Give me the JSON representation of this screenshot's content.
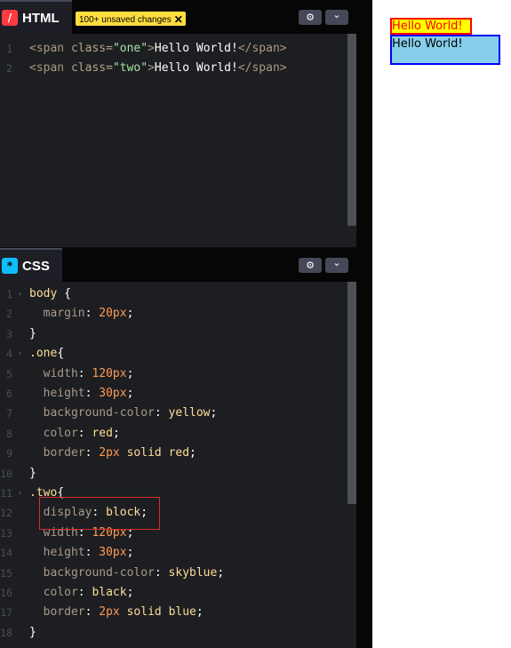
{
  "html_pane": {
    "tab_label": "HTML",
    "icon": "html-slash-icon",
    "icon_glyph": "/",
    "badge_text": "100+ unsaved changes",
    "badge_close": "✕",
    "settings_icon": "gear-icon",
    "settings_glyph": "⚙",
    "collapse_icon": "chevron-down-icon",
    "collapse_glyph": "⌄",
    "lines": [
      {
        "n": "1",
        "tokens": [
          [
            "tag",
            "<span "
          ],
          [
            "attr",
            "class="
          ],
          [
            "str",
            "\"one\""
          ],
          [
            "tag",
            ">"
          ],
          [
            "txt",
            "Hello World!"
          ],
          [
            "tag",
            "</span>"
          ]
        ]
      },
      {
        "n": "2",
        "tokens": [
          [
            "tag",
            "<span "
          ],
          [
            "attr",
            "class="
          ],
          [
            "str",
            "\"two\""
          ],
          [
            "tag",
            ">"
          ],
          [
            "txt",
            "Hello World!"
          ],
          [
            "tag",
            "</span>"
          ]
        ]
      }
    ]
  },
  "css_pane": {
    "tab_label": "CSS",
    "icon": "css-asterisk-icon",
    "icon_glyph": "*",
    "settings_icon": "gear-icon",
    "settings_glyph": "⚙",
    "collapse_icon": "chevron-down-icon",
    "collapse_glyph": "⌄",
    "lines": [
      {
        "n": "1",
        "fold": true,
        "tokens": [
          [
            "sel",
            "body "
          ],
          [
            "pun",
            "{"
          ]
        ]
      },
      {
        "n": "2",
        "tokens": [
          [
            "pun",
            "  "
          ],
          [
            "prop",
            "margin"
          ],
          [
            "pun",
            ": "
          ],
          [
            "num",
            "20px"
          ],
          [
            "pun",
            ";"
          ]
        ]
      },
      {
        "n": "3",
        "tokens": [
          [
            "pun",
            "}"
          ]
        ]
      },
      {
        "n": "4",
        "fold": true,
        "tokens": [
          [
            "sel",
            ".one"
          ],
          [
            "pun",
            "{"
          ]
        ]
      },
      {
        "n": "5",
        "tokens": [
          [
            "pun",
            "  "
          ],
          [
            "prop",
            "width"
          ],
          [
            "pun",
            ": "
          ],
          [
            "num",
            "120px"
          ],
          [
            "pun",
            ";"
          ]
        ]
      },
      {
        "n": "6",
        "tokens": [
          [
            "pun",
            "  "
          ],
          [
            "prop",
            "height"
          ],
          [
            "pun",
            ": "
          ],
          [
            "num",
            "30px"
          ],
          [
            "pun",
            ";"
          ]
        ]
      },
      {
        "n": "7",
        "tokens": [
          [
            "pun",
            "  "
          ],
          [
            "prop",
            "background-color"
          ],
          [
            "pun",
            ": "
          ],
          [
            "kw",
            "yellow"
          ],
          [
            "pun",
            ";"
          ]
        ]
      },
      {
        "n": "8",
        "tokens": [
          [
            "pun",
            "  "
          ],
          [
            "prop",
            "color"
          ],
          [
            "pun",
            ": "
          ],
          [
            "kw",
            "red"
          ],
          [
            "pun",
            ";"
          ]
        ]
      },
      {
        "n": "9",
        "tokens": [
          [
            "pun",
            "  "
          ],
          [
            "prop",
            "border"
          ],
          [
            "pun",
            ": "
          ],
          [
            "num",
            "2px"
          ],
          [
            "pun",
            " "
          ],
          [
            "kw",
            "solid"
          ],
          [
            "pun",
            " "
          ],
          [
            "kw",
            "red"
          ],
          [
            "pun",
            ";"
          ]
        ]
      },
      {
        "n": "10",
        "tokens": [
          [
            "pun",
            "}"
          ]
        ]
      },
      {
        "n": "11",
        "fold": true,
        "tokens": [
          [
            "sel",
            ".two"
          ],
          [
            "pun",
            "{"
          ]
        ]
      },
      {
        "n": "12",
        "tokens": [
          [
            "pun",
            "  "
          ],
          [
            "prop",
            "display"
          ],
          [
            "pun",
            ": "
          ],
          [
            "kw",
            "block"
          ],
          [
            "pun",
            ";"
          ]
        ]
      },
      {
        "n": "13",
        "tokens": [
          [
            "pun",
            "  "
          ],
          [
            "prop",
            "width"
          ],
          [
            "pun",
            ": "
          ],
          [
            "num",
            "120px"
          ],
          [
            "pun",
            ";"
          ]
        ]
      },
      {
        "n": "14",
        "tokens": [
          [
            "pun",
            "  "
          ],
          [
            "prop",
            "height"
          ],
          [
            "pun",
            ": "
          ],
          [
            "num",
            "30px"
          ],
          [
            "pun",
            ";"
          ]
        ]
      },
      {
        "n": "15",
        "tokens": [
          [
            "pun",
            "  "
          ],
          [
            "prop",
            "background-color"
          ],
          [
            "pun",
            ": "
          ],
          [
            "kw",
            "skyblue"
          ],
          [
            "pun",
            ";"
          ]
        ]
      },
      {
        "n": "16",
        "tokens": [
          [
            "pun",
            "  "
          ],
          [
            "prop",
            "color"
          ],
          [
            "pun",
            ": "
          ],
          [
            "kw",
            "black"
          ],
          [
            "pun",
            ";"
          ]
        ]
      },
      {
        "n": "17",
        "tokens": [
          [
            "pun",
            "  "
          ],
          [
            "prop",
            "border"
          ],
          [
            "pun",
            ": "
          ],
          [
            "num",
            "2px"
          ],
          [
            "pun",
            " "
          ],
          [
            "kw",
            "solid"
          ],
          [
            "pun",
            " "
          ],
          [
            "kw",
            "blue"
          ],
          [
            "pun",
            ";"
          ]
        ]
      },
      {
        "n": "18",
        "tokens": [
          [
            "pun",
            "}"
          ]
        ]
      }
    ]
  },
  "preview": {
    "one_text": "Hello World!",
    "two_text": "Hello World!"
  },
  "colors": {
    "html_icon": "#ff3c41",
    "css_icon": "#0ebeff",
    "badge": "#ffdd40",
    "highlight_box": "#d32f2f"
  }
}
